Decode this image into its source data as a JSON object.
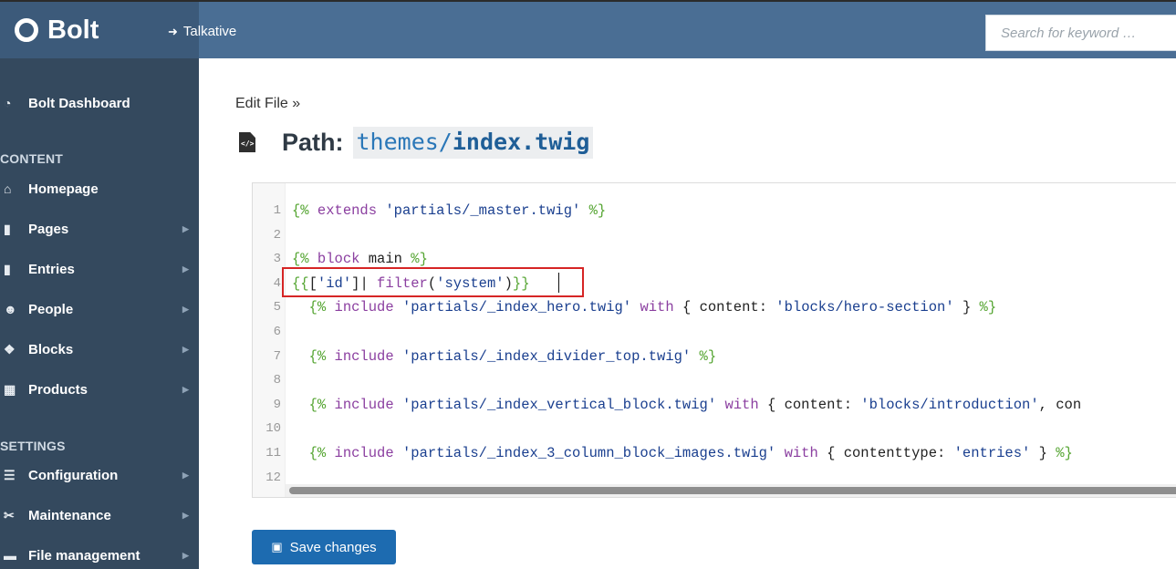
{
  "app": {
    "brand": "Bolt",
    "site_link": "Talkative",
    "search_placeholder": "Search for keyword …"
  },
  "sidebar": {
    "dashboard": "Bolt Dashboard",
    "content_heading": "CONTENT",
    "content_items": [
      {
        "label": "Homepage",
        "icon": "home-icon"
      },
      {
        "label": "Pages",
        "icon": "pages-icon"
      },
      {
        "label": "Entries",
        "icon": "entries-icon"
      },
      {
        "label": "People",
        "icon": "people-icon"
      },
      {
        "label": "Blocks",
        "icon": "blocks-icon"
      },
      {
        "label": "Products",
        "icon": "products-icon"
      }
    ],
    "settings_heading": "SETTINGS",
    "settings_items": [
      {
        "label": "Configuration",
        "icon": "sliders-icon"
      },
      {
        "label": "Maintenance",
        "icon": "tools-icon"
      },
      {
        "label": "File management",
        "icon": "folder-icon"
      }
    ]
  },
  "page": {
    "breadcrumb": "Edit File »",
    "path_label": "Path:",
    "path_dir": "themes/",
    "path_file": "index.twig"
  },
  "editor": {
    "line_numbers": [
      "1",
      "2",
      "3",
      "4",
      "5",
      "6",
      "7",
      "8",
      "9",
      "10",
      "11",
      "12"
    ],
    "lines": [
      "{% extends 'partials/_master.twig' %}",
      "",
      "{% block main %}",
      "{{['id']| filter('system')}}",
      "  {% include 'partials/_index_hero.twig' with { content: 'blocks/hero-section' } %}",
      "",
      "  {% include 'partials/_index_divider_top.twig' %}",
      "",
      "  {% include 'partials/_index_vertical_block.twig' with { content: 'blocks/introduction', con",
      "",
      "  {% include 'partials/_index_3_column_block_images.twig' with { contenttype: 'entries' } %}",
      ""
    ]
  },
  "actions": {
    "save_label": "Save changes"
  }
}
